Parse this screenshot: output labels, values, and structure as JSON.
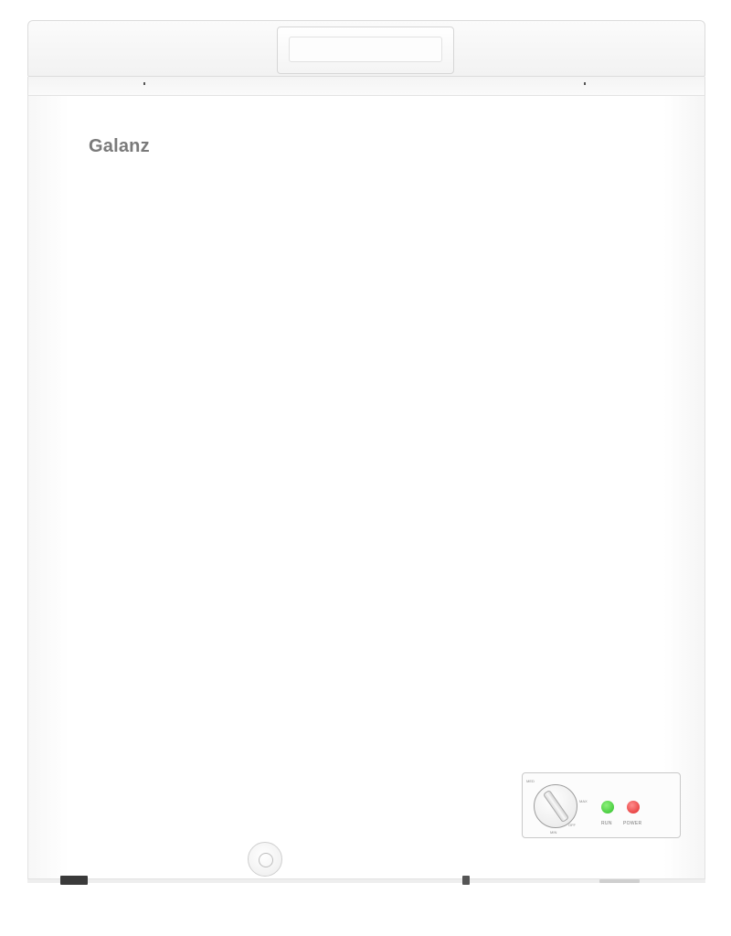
{
  "brand": "Galanz",
  "control_panel": {
    "dial_labels": [
      "MED",
      "MAX",
      "OFF",
      "MIN"
    ],
    "run_label": "RUN",
    "power_label": "POWER"
  },
  "colors": {
    "cabinet": "#ffffff",
    "run_light": "#2fbf2a",
    "power_light": "#e02a2a",
    "logo_text": "#7a7a7a"
  }
}
